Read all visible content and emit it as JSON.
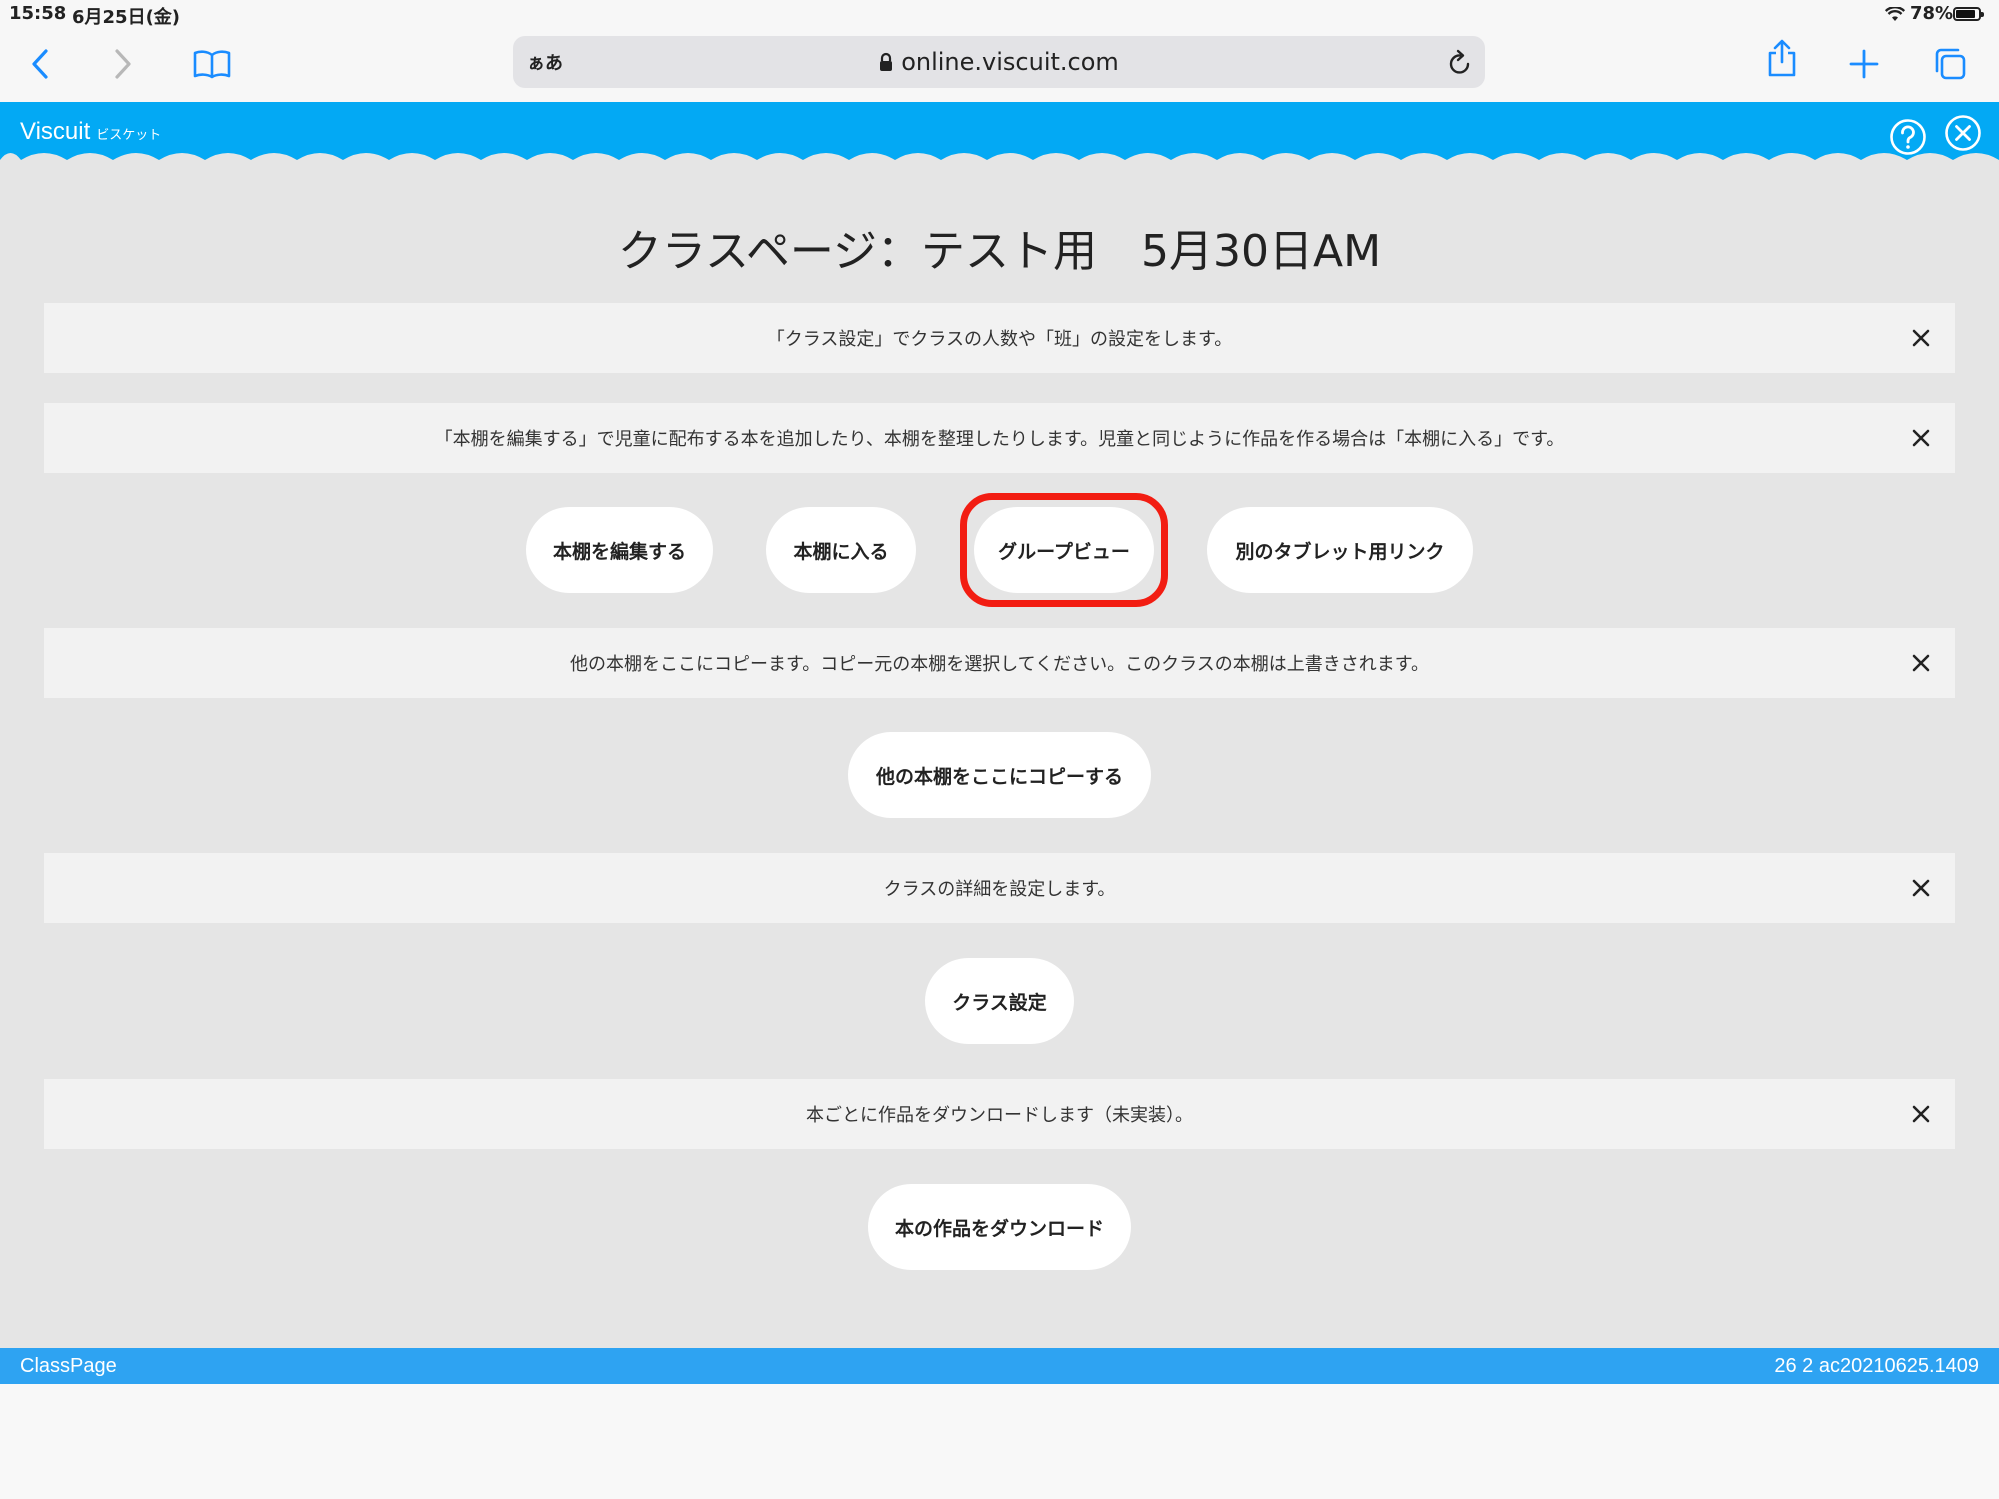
{
  "status_bar": {
    "time": "15:58",
    "date": "6月25日(金)",
    "battery": "78%"
  },
  "browser": {
    "text_size_label": "ぁあ",
    "url": "online.viscuit.com"
  },
  "app_header": {
    "logo": "Viscuit",
    "logo_sub": "ビスケット",
    "color": "#03a9f4"
  },
  "page": {
    "title": "クラスページ：テスト用　5月30日AM"
  },
  "sections": [
    {
      "info": "「クラス設定」でクラスの人数や「班」の設定をします。"
    },
    {
      "info": "「本棚を編集する」で児童に配布する本を追加したり、本棚を整理したりします。児童と同じように作品を作る場合は「本棚に入る」です。"
    },
    {
      "info": "他の本棚をここにコピーます。コピー元の本棚を選択してください。このクラスの本棚は上書きされます。"
    },
    {
      "info": "クラスの詳細を設定します。"
    },
    {
      "info": "本ごとに作品をダウンロードします（未実装）。"
    }
  ],
  "buttons": {
    "edit_shelf": "本棚を編集する",
    "enter_shelf": "本棚に入る",
    "group_view": "グループビュー",
    "tablet_link": "別のタブレット用リンク",
    "copy_shelf": "他の本棚をここにコピーする",
    "class_settings": "クラス設定",
    "download_works": "本の作品をダウンロード"
  },
  "footer": {
    "left": "ClassPage",
    "right": "26 2 ac20210625.1409",
    "color": "#2ea3f2"
  },
  "highlight_color": "#f21d12"
}
